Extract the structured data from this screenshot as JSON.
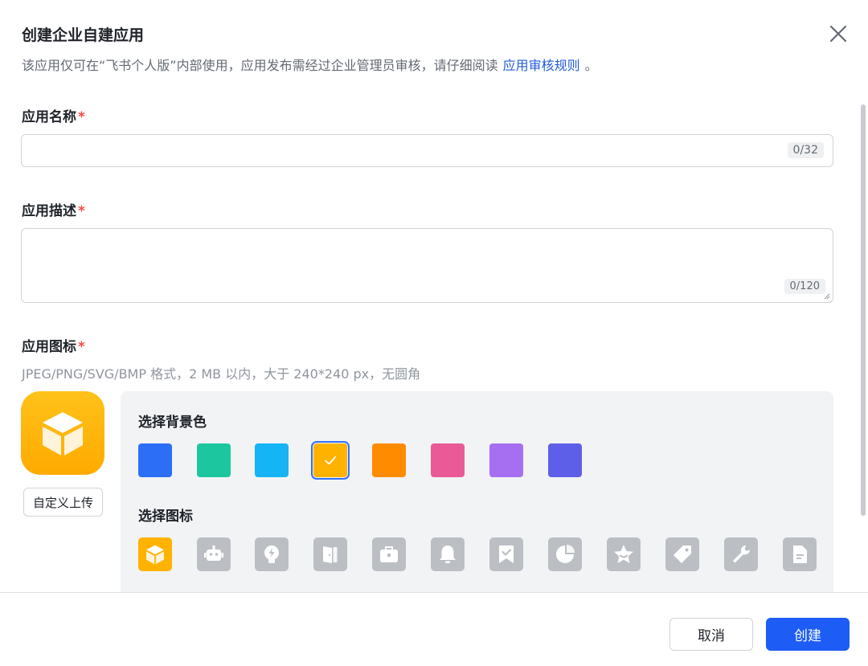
{
  "dialog": {
    "title": "创建企业自建应用",
    "subtitle": "该应用仅可在“飞书个人版”内部使用，应用发布需经过企业管理员审核，请仔细阅读",
    "subtitle_link": "应用审核规则",
    "subtitle_end": "。"
  },
  "name_field": {
    "label": "应用名称",
    "required_mark": "*",
    "value": "",
    "counter": "0/32"
  },
  "desc_field": {
    "label": "应用描述",
    "required_mark": "*",
    "value": "",
    "counter": "0/120"
  },
  "icon_field": {
    "label": "应用图标",
    "required_mark": "*",
    "hint": "JPEG/PNG/SVG/BMP 格式，2 MB 以内，大于 240*240 px，无圆角",
    "upload_label": "自定义上传"
  },
  "picker": {
    "bg_label": "选择背景色",
    "icon_label": "选择图标",
    "colors": [
      "#2d6ef7",
      "#1cc7a0",
      "#14b4f5",
      "#ffb300",
      "#ff8c00",
      "#ea5a96",
      "#a66ff2",
      "#5d5fe8"
    ],
    "selected_color_index": 3,
    "icons": [
      "cube-icon",
      "robot-icon",
      "lightbulb-icon",
      "door-icon",
      "briefcase-icon",
      "bell-icon",
      "bookmark-check-icon",
      "pie-chart-icon",
      "star-badge-icon",
      "tag-icon",
      "wrench-icon",
      "document-icon"
    ],
    "selected_icon_index": 0
  },
  "footer": {
    "cancel_label": "取消",
    "create_label": "创建"
  }
}
